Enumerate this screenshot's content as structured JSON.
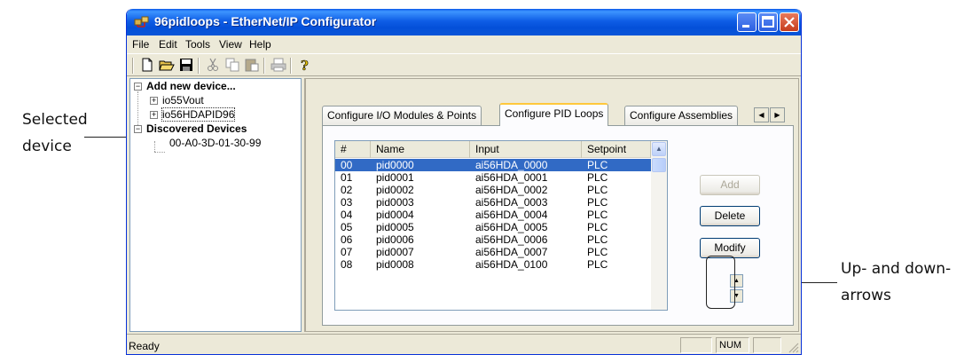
{
  "callouts": {
    "selected_device": [
      "Selected",
      "device"
    ],
    "arrows": [
      "Up- and down-",
      "arrows"
    ]
  },
  "window": {
    "title": "96pidloops - EtherNet/IP Configurator",
    "menu": [
      "File",
      "Edit",
      "Tools",
      "View",
      "Help"
    ],
    "toolbar_icons": [
      "new-file-icon",
      "open-folder-icon",
      "save-icon",
      "cut-icon",
      "copy-icon",
      "paste-icon",
      "print-icon",
      "help-icon"
    ]
  },
  "tree": {
    "add_new": "Add new device...",
    "devices": [
      "io55Vout",
      "io56HDAPID96"
    ],
    "discovered": "Discovered Devices",
    "discovered_items": [
      "00-A0-3D-01-30-99"
    ],
    "selected": "io56HDAPID96"
  },
  "tabs": {
    "items": [
      "Configure I/O Modules & Points",
      "Configure PID Loops",
      "Configure Assemblies"
    ],
    "active": "Configure PID Loops"
  },
  "list": {
    "columns": [
      "#",
      "Name",
      "Input",
      "Setpoint"
    ],
    "rows": [
      [
        "00",
        "pid0000",
        "ai56HDA_0000",
        "PLC"
      ],
      [
        "01",
        "pid0001",
        "ai56HDA_0001",
        "PLC"
      ],
      [
        "02",
        "pid0002",
        "ai56HDA_0002",
        "PLC"
      ],
      [
        "03",
        "pid0003",
        "ai56HDA_0003",
        "PLC"
      ],
      [
        "04",
        "pid0004",
        "ai56HDA_0004",
        "PLC"
      ],
      [
        "05",
        "pid0005",
        "ai56HDA_0005",
        "PLC"
      ],
      [
        "06",
        "pid0006",
        "ai56HDA_0006",
        "PLC"
      ],
      [
        "07",
        "pid0007",
        "ai56HDA_0007",
        "PLC"
      ],
      [
        "08",
        "pid0008",
        "ai56HDA_0100",
        "PLC"
      ]
    ],
    "selected_row": 0
  },
  "buttons": {
    "add": "Add",
    "delete": "Delete",
    "modify": "Modify"
  },
  "status": {
    "text": "Ready",
    "num": "NUM"
  },
  "colors": {
    "title_blue": "#0450d9",
    "selection": "#316ac5"
  }
}
